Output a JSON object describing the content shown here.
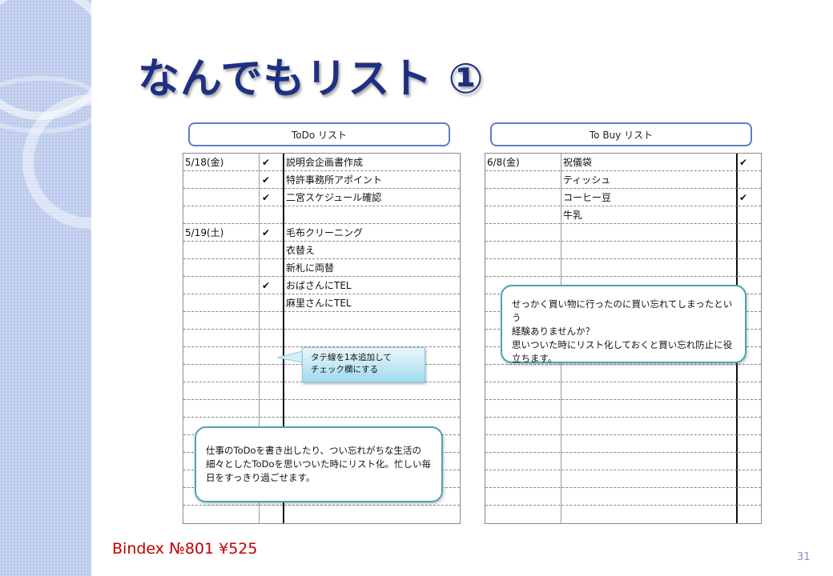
{
  "title": "なんでもリスト ①",
  "todo": {
    "header": "ToDo リスト",
    "rows": [
      {
        "date": "5/18(金)",
        "check": "✔",
        "task": "説明会企画書作成"
      },
      {
        "date": "",
        "check": "✔",
        "task": "特許事務所アポイント"
      },
      {
        "date": "",
        "check": "✔",
        "task": "二宮スケジュール確認"
      },
      {
        "date": "",
        "check": "",
        "task": ""
      },
      {
        "date": "5/19(土)",
        "check": "✔",
        "task": "毛布クリーニング"
      },
      {
        "date": "",
        "check": "",
        "task": "衣替え"
      },
      {
        "date": "",
        "check": "",
        "task": "新札に両替"
      },
      {
        "date": "",
        "check": "✔",
        "task": "おばさんにTEL"
      },
      {
        "date": "",
        "check": "",
        "task": "麻里さんにTEL"
      }
    ],
    "callout": {
      "line1": "タテ線を1本追加して",
      "line2": "チェック欄にする"
    },
    "note": {
      "line1": "仕事のToDoを書き出したり、つい忘れがちな生活の",
      "line2": "細々としたToDoを思いついた時にリスト化。忙しい毎",
      "line3": "日をすっきり過ごせます。"
    }
  },
  "tobuy": {
    "header": "To Buy リスト",
    "rows": [
      {
        "date": "6/8(金)",
        "item": "祝儀袋",
        "check": "✔"
      },
      {
        "date": "",
        "item": "ティッシュ",
        "check": ""
      },
      {
        "date": "",
        "item": "コーヒー豆",
        "check": "✔"
      },
      {
        "date": "",
        "item": "牛乳",
        "check": ""
      }
    ],
    "note": {
      "line1": "せっかく買い物に行ったのに買い忘れてしまったという",
      "line2": "経験ありませんか？",
      "line3": "思いついた時にリスト化しておくと買い忘れ防止に役",
      "line4": "立ちます。"
    }
  },
  "footer": "Bindex №801 ¥525",
  "page_number": "31",
  "colors": {
    "title": "#1f2f82",
    "footer": "#c00000",
    "header_border": "#5b7fc2",
    "note_border": "#4ba4b4"
  }
}
